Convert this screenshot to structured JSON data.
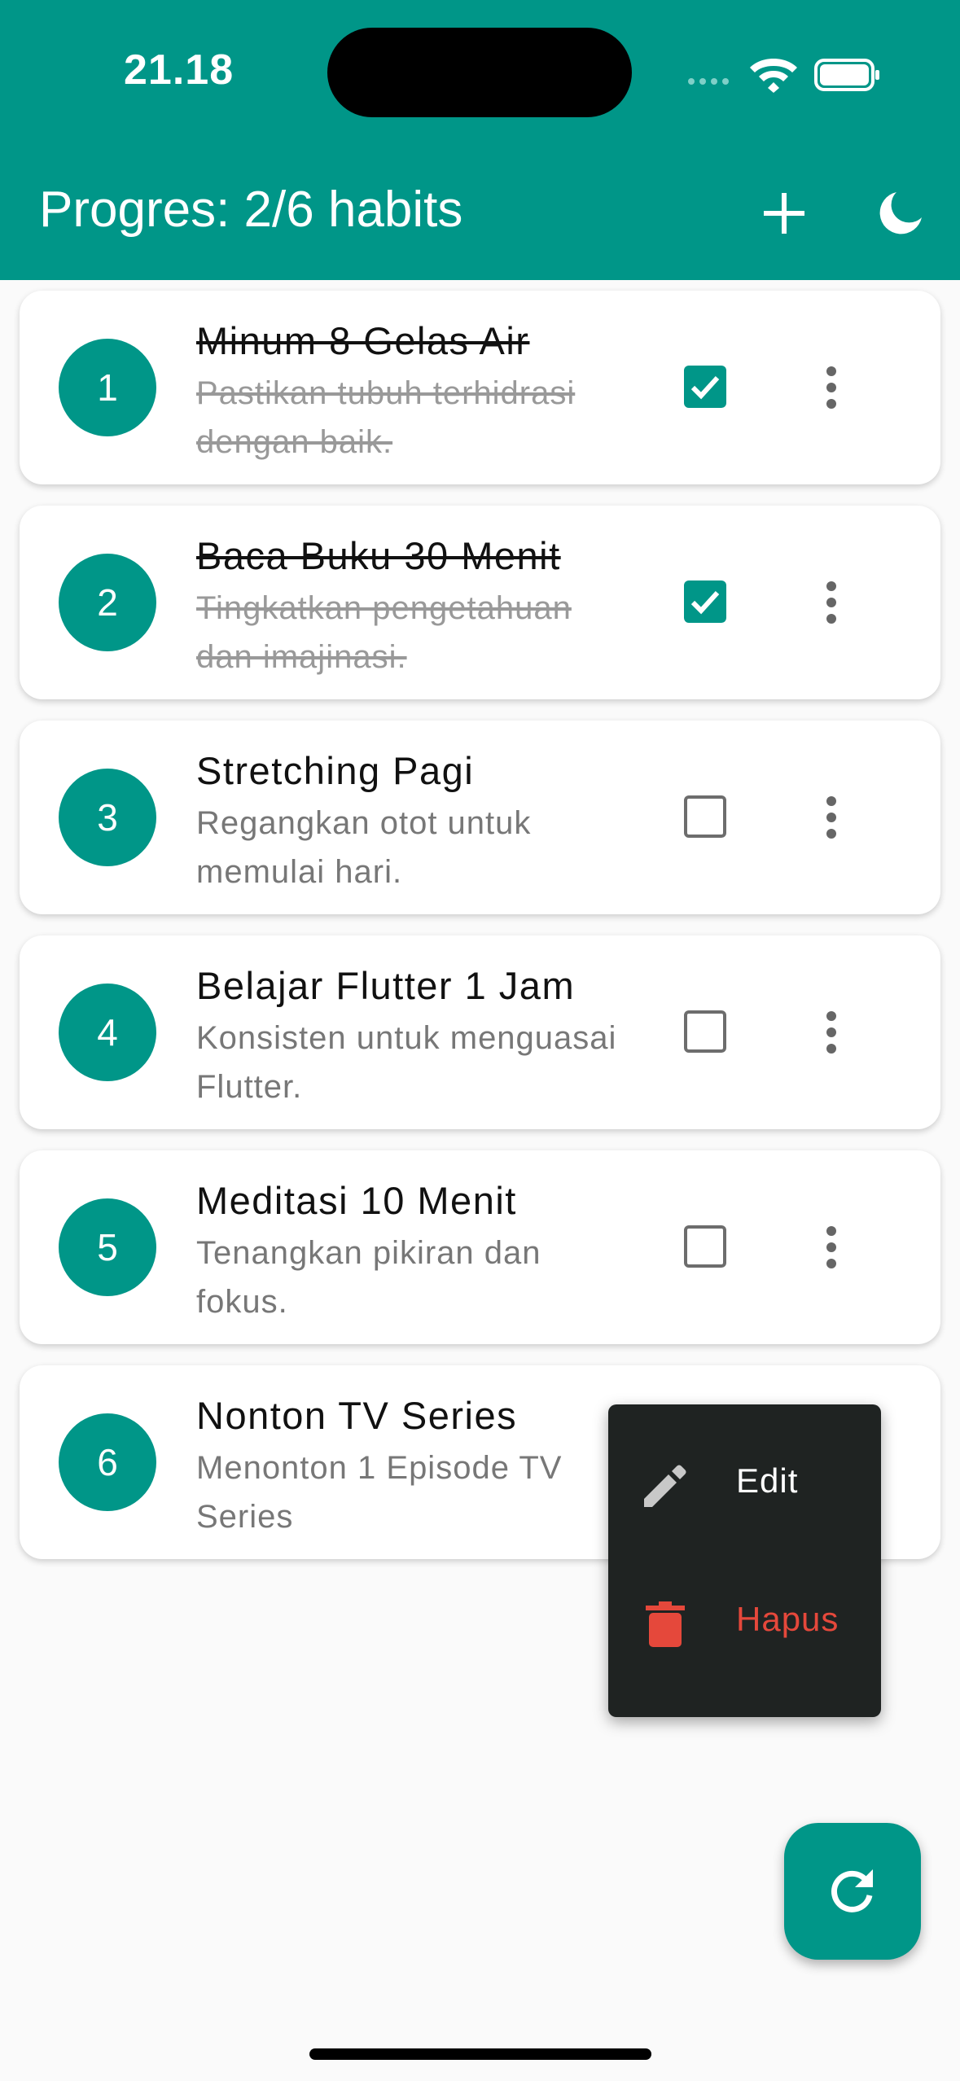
{
  "status_bar": {
    "time": "21.18"
  },
  "app_bar": {
    "title": "Progres: 2/6 habits",
    "color": "#009688",
    "actions": [
      {
        "icon": "add-icon"
      },
      {
        "icon": "moon-icon"
      }
    ]
  },
  "habits": [
    {
      "number": "1",
      "title": "Minum 8 Gelas Air",
      "description": "Pastikan tubuh terhidrasi dengan baik.",
      "completed": true
    },
    {
      "number": "2",
      "title": "Baca Buku 30 Menit",
      "description": "Tingkatkan pengetahuan dan imajinasi.",
      "completed": true
    },
    {
      "number": "3",
      "title": "Stretching Pagi",
      "description": "Regangkan otot untuk memulai hari.",
      "completed": false
    },
    {
      "number": "4",
      "title": "Belajar Flutter 1 Jam",
      "description": "Konsisten untuk menguasai Flutter.",
      "completed": false
    },
    {
      "number": "5",
      "title": "Meditasi 10 Menit",
      "description": "Tenangkan pikiran dan fokus.",
      "completed": false
    },
    {
      "number": "6",
      "title": "Nonton TV Series",
      "description": "Menonton 1 Episode TV Series",
      "completed": false
    }
  ],
  "context_menu": {
    "items": [
      {
        "label": "Edit",
        "icon": "pencil-icon",
        "color": "#ffffff"
      },
      {
        "label": "Hapus",
        "icon": "trash-icon",
        "color": "#e5483b"
      }
    ]
  },
  "fab": {
    "icon": "refresh-icon"
  }
}
